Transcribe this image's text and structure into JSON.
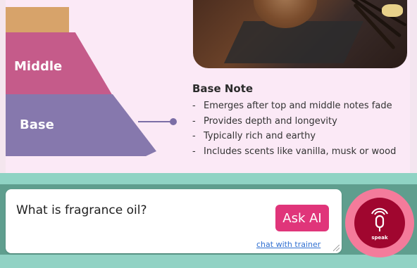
{
  "pyramid": {
    "middle_label": "Middle",
    "base_label": "Base"
  },
  "note": {
    "title": "Base Note",
    "bullets": [
      "Emerges after top and middle notes fade",
      "Provides depth and longevity",
      "Typically rich and earthy",
      "Includes scents like vanilla, musk or wood"
    ]
  },
  "chat": {
    "question": "What is fragrance oil?",
    "ask_label": "Ask AI",
    "trainer_link": "chat with trainer",
    "speak_label": "speak"
  },
  "colors": {
    "top_tier": "#d7a36a",
    "middle_tier": "#c55b8a",
    "base_tier": "#8678ad",
    "ask_button": "#e0357a",
    "mic_button": "#a0062f"
  },
  "icons": {
    "mic": "microphone-icon"
  }
}
